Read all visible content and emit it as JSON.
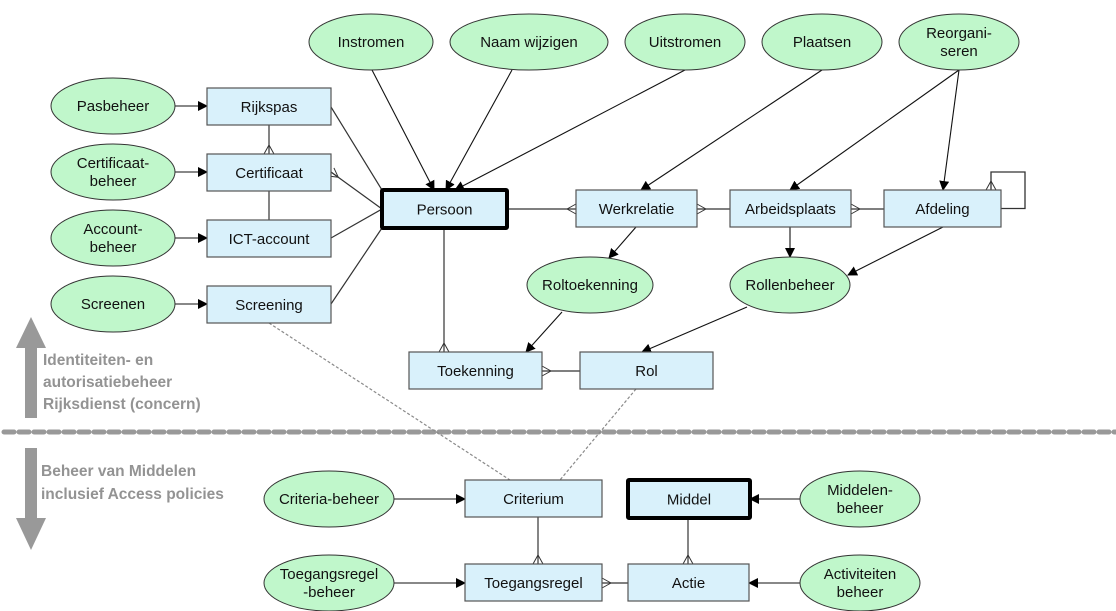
{
  "colors": {
    "process_fill": "#c0f7cb",
    "entity_fill": "#d9f1fb",
    "line": "#000000",
    "band": "#999999",
    "band_text": "#939393"
  },
  "bands": {
    "upper": {
      "label_lines": [
        "Identiteiten- en",
        "autorisatiebeheer",
        "Rijksdienst (concern)"
      ]
    },
    "lower": {
      "label_lines": [
        "Beheer van Middelen",
        "inclusief Access policies"
      ]
    }
  },
  "entities": [
    {
      "id": "rijkspas",
      "label": "Rijkspas",
      "emphasis": false
    },
    {
      "id": "certificaat",
      "label": "Certificaat",
      "emphasis": false
    },
    {
      "id": "ict-account",
      "label": "ICT-account",
      "emphasis": false
    },
    {
      "id": "screening",
      "label": "Screening",
      "emphasis": false
    },
    {
      "id": "persoon",
      "label": "Persoon",
      "emphasis": true
    },
    {
      "id": "werkrelatie",
      "label": "Werkrelatie",
      "emphasis": false
    },
    {
      "id": "arbeidsplaats",
      "label": "Arbeidsplaats",
      "emphasis": false
    },
    {
      "id": "afdeling",
      "label": "Afdeling",
      "emphasis": false
    },
    {
      "id": "toekenning",
      "label": "Toekenning",
      "emphasis": false
    },
    {
      "id": "rol",
      "label": "Rol",
      "emphasis": false
    },
    {
      "id": "criterium",
      "label": "Criterium",
      "emphasis": false
    },
    {
      "id": "middel",
      "label": "Middel",
      "emphasis": true
    },
    {
      "id": "toegangsregel",
      "label": "Toegangsregel",
      "emphasis": false
    },
    {
      "id": "actie",
      "label": "Actie",
      "emphasis": false
    }
  ],
  "processes": [
    {
      "id": "instromen",
      "lines": [
        "Instromen"
      ]
    },
    {
      "id": "naam-wijzigen",
      "lines": [
        "Naam wijzigen"
      ]
    },
    {
      "id": "uitstromen",
      "lines": [
        "Uitstromen"
      ]
    },
    {
      "id": "plaatsen",
      "lines": [
        "Plaatsen"
      ]
    },
    {
      "id": "reorganiseren",
      "lines": [
        "Reorgani-",
        "seren"
      ]
    },
    {
      "id": "pasbeheer",
      "lines": [
        "Pasbeheer"
      ]
    },
    {
      "id": "certificaatbeheer",
      "lines": [
        "Certificaat-",
        "beheer"
      ]
    },
    {
      "id": "accountbeheer",
      "lines": [
        "Account-",
        "beheer"
      ]
    },
    {
      "id": "screenen",
      "lines": [
        "Screenen"
      ]
    },
    {
      "id": "roltoekenning",
      "lines": [
        "Roltoekenning"
      ]
    },
    {
      "id": "rollenbeheer",
      "lines": [
        "Rollenbeheer"
      ]
    },
    {
      "id": "criteriabeheer",
      "lines": [
        "Criteria-beheer"
      ]
    },
    {
      "id": "toegangsregelbeheer",
      "lines": [
        "Toegangsregel",
        "-beheer"
      ]
    },
    {
      "id": "middelenbeheer",
      "lines": [
        "Middelen-",
        "beheer"
      ]
    },
    {
      "id": "activiteitenbeheer",
      "lines": [
        "Activiteiten",
        "beheer"
      ]
    }
  ],
  "process_arrows": [
    {
      "from": "instromen",
      "to": "persoon"
    },
    {
      "from": "naam-wijzigen",
      "to": "persoon"
    },
    {
      "from": "uitstromen",
      "to": "persoon"
    },
    {
      "from": "plaatsen",
      "to": "werkrelatie"
    },
    {
      "from": "reorganiseren",
      "to": "arbeidsplaats"
    },
    {
      "from": "reorganiseren",
      "to": "afdeling"
    },
    {
      "from": "pasbeheer",
      "to": "rijkspas"
    },
    {
      "from": "certificaatbeheer",
      "to": "certificaat"
    },
    {
      "from": "accountbeheer",
      "to": "ict-account"
    },
    {
      "from": "screenen",
      "to": "screening"
    },
    {
      "from": "werkrelatie",
      "to": "roltoekenning"
    },
    {
      "from": "arbeidsplaats",
      "to": "rollenbeheer"
    },
    {
      "from": "afdeling",
      "to": "rollenbeheer"
    },
    {
      "from": "roltoekenning",
      "to": "toekenning"
    },
    {
      "from": "rollenbeheer",
      "to": "rol"
    },
    {
      "from": "criteriabeheer",
      "to": "criterium"
    },
    {
      "from": "toegangsregelbeheer",
      "to": "toegangsregel"
    },
    {
      "from": "middelenbeheer",
      "to": "middel"
    },
    {
      "from": "activiteitenbeheer",
      "to": "actie"
    }
  ],
  "relations": [
    {
      "from": "rijkspas",
      "to": "certificaat",
      "many_end": "certificaat"
    },
    {
      "from": "certificaat",
      "to": "ict-account",
      "many_end": null
    },
    {
      "from": "rijkspas",
      "to": "persoon",
      "many_end": null
    },
    {
      "from": "certificaat",
      "to": "persoon",
      "many_end": "certificaat"
    },
    {
      "from": "ict-account",
      "to": "persoon",
      "many_end": null
    },
    {
      "from": "screening",
      "to": "persoon",
      "many_end": null
    },
    {
      "from": "persoon",
      "to": "werkrelatie",
      "many_end": "werkrelatie"
    },
    {
      "from": "werkrelatie",
      "to": "arbeidsplaats",
      "many_end": "werkrelatie"
    },
    {
      "from": "arbeidsplaats",
      "to": "afdeling",
      "many_end": "arbeidsplaats"
    },
    {
      "from": "afdeling",
      "to": "afdeling",
      "many_end": "afdeling"
    },
    {
      "from": "persoon",
      "to": "toekenning",
      "many_end": "toekenning"
    },
    {
      "from": "toekenning",
      "to": "rol",
      "many_end": "toekenning"
    },
    {
      "from": "criterium",
      "to": "toegangsregel",
      "many_end": "toegangsregel"
    },
    {
      "from": "middel",
      "to": "actie",
      "many_end": "actie"
    },
    {
      "from": "toegangsregel",
      "to": "actie",
      "many_end": "toegangsregel"
    }
  ],
  "dotted_links": [
    {
      "from": "screening",
      "to": "criterium"
    },
    {
      "from": "rol",
      "to": "criterium"
    }
  ]
}
